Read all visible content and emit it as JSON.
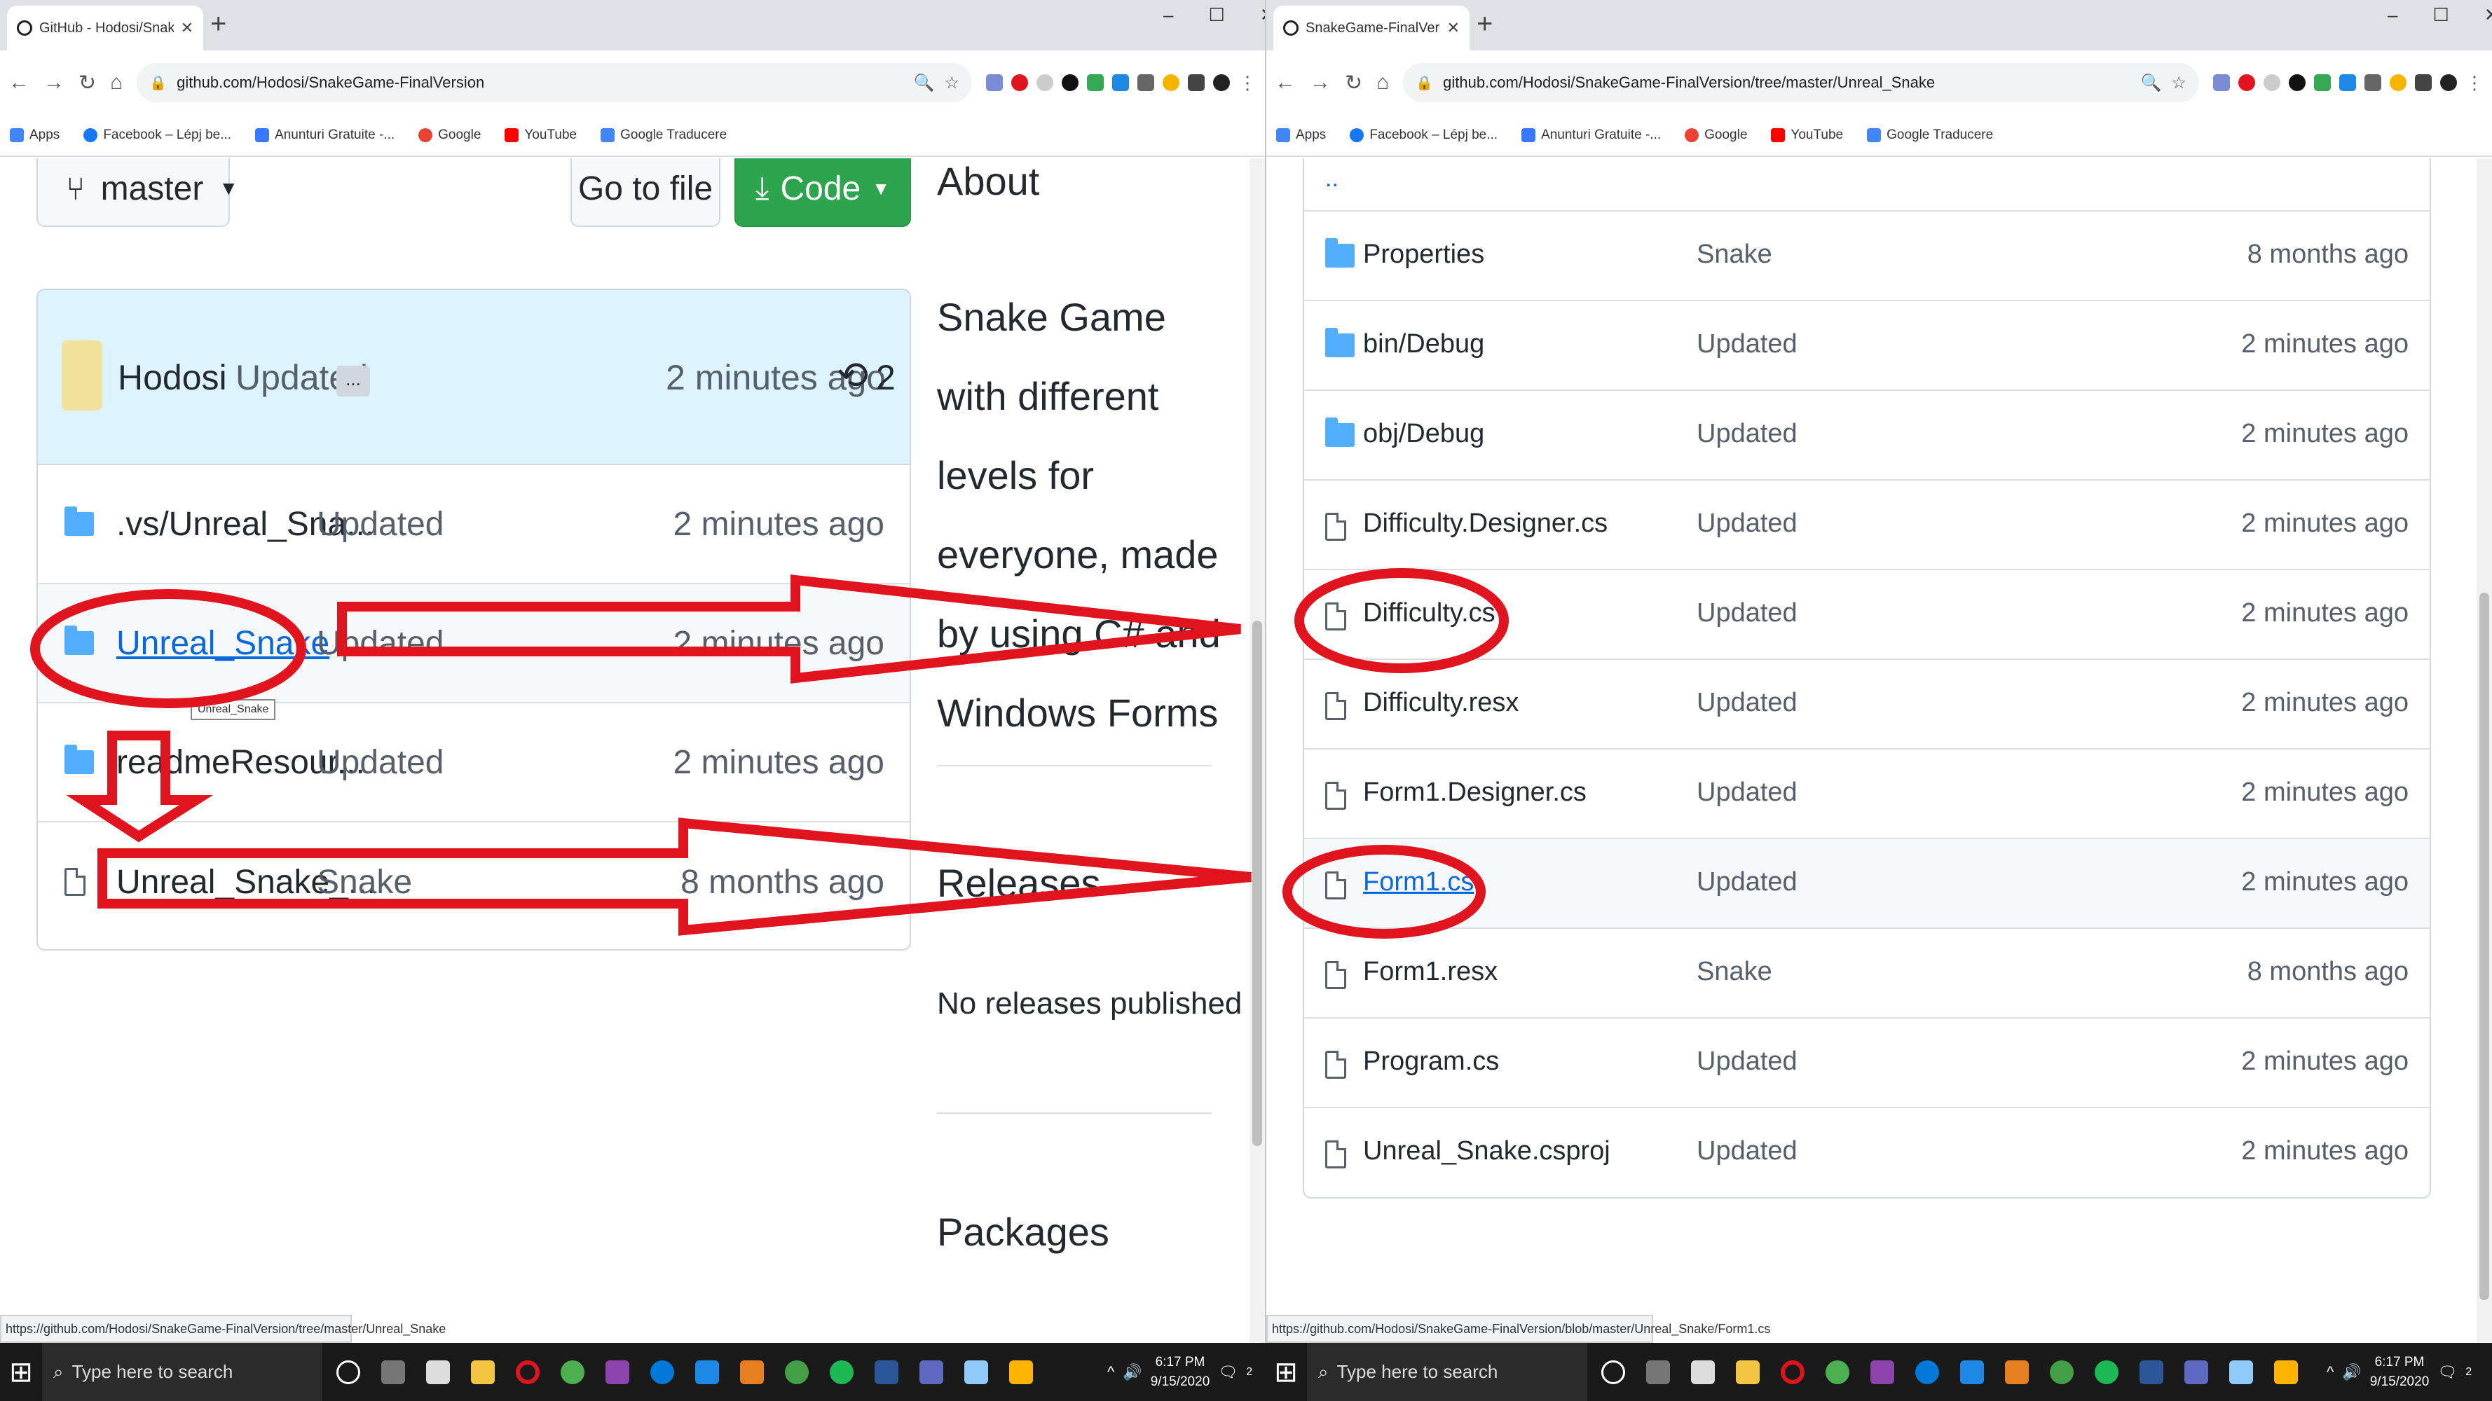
{
  "left_browser": {
    "tab_title": "GitHub - Hodosi/SnakeGame-Fi",
    "url": "github.com/Hodosi/SnakeGame-FinalVersion",
    "branch_label": "master",
    "go_to_file_label": "Go to file",
    "code_label": "Code",
    "commit": {
      "author": "Hodosi",
      "message": "Updated",
      "ellipsis": "...",
      "time": "2 minutes ago",
      "count": "2"
    },
    "files": [
      {
        "name": ".vs/Unreal_Sna...",
        "message": "Updated",
        "age": "2 minutes ago",
        "type": "folder"
      },
      {
        "name": "Unreal_Snake",
        "message": "Updated",
        "age": "2 minutes ago",
        "type": "folder",
        "link": true
      },
      {
        "name": "readmeResour...",
        "message": "Updated",
        "age": "2 minutes ago",
        "type": "folder"
      },
      {
        "name": "Unreal_Snake_...",
        "message": "Snake",
        "age": "8 months ago",
        "type": "file"
      }
    ],
    "tooltip": "Unreal_Snake",
    "about_title": "About",
    "about_desc": "Snake Game with different levels for everyone, made by using C# and Windows Forms",
    "releases_title": "Releases",
    "releases_text": "No releases published",
    "packages_title": "Packages",
    "status_url": "https://github.com/Hodosi/SnakeGame-FinalVersion/tree/master/Unreal_Snake"
  },
  "right_browser": {
    "tab_title": "SnakeGame-FinalVersion/Unrea",
    "url": "github.com/Hodosi/SnakeGame-FinalVersion/tree/master/Unreal_Snake",
    "parent_dir": "..",
    "files": [
      {
        "name": "Properties",
        "message": "Snake",
        "age": "8 months ago",
        "type": "folder"
      },
      {
        "name": "bin/Debug",
        "message": "Updated",
        "age": "2 minutes ago",
        "type": "folder"
      },
      {
        "name": "obj/Debug",
        "message": "Updated",
        "age": "2 minutes ago",
        "type": "folder"
      },
      {
        "name": "Difficulty.Designer.cs",
        "message": "Updated",
        "age": "2 minutes ago",
        "type": "file"
      },
      {
        "name": "Difficulty.cs",
        "message": "Updated",
        "age": "2 minutes ago",
        "type": "file"
      },
      {
        "name": "Difficulty.resx",
        "message": "Updated",
        "age": "2 minutes ago",
        "type": "file"
      },
      {
        "name": "Form1.Designer.cs",
        "message": "Updated",
        "age": "2 minutes ago",
        "type": "file"
      },
      {
        "name": "Form1.cs",
        "message": "Updated",
        "age": "2 minutes ago",
        "type": "file",
        "link": true
      },
      {
        "name": "Form1.resx",
        "message": "Snake",
        "age": "8 months ago",
        "type": "file"
      },
      {
        "name": "Program.cs",
        "message": "Updated",
        "age": "2 minutes ago",
        "type": "file"
      },
      {
        "name": "Unreal_Snake.csproj",
        "message": "Updated",
        "age": "2 minutes ago",
        "type": "file"
      }
    ],
    "status_url": "https://github.com/Hodosi/SnakeGame-FinalVersion/blob/master/Unreal_Snake/Form1.cs"
  },
  "bookmarks": [
    {
      "label": "Apps",
      "icon": "apps-icon",
      "color": "#4285f4"
    },
    {
      "label": "Facebook – Lépj be...",
      "icon": "facebook-icon",
      "color": "#1877f2"
    },
    {
      "label": "Anunturi Gratuite -...",
      "icon": "olx-icon",
      "color": "#3a77ff"
    },
    {
      "label": "Google",
      "icon": "google-icon",
      "color": "#ea4335"
    },
    {
      "label": "YouTube",
      "icon": "youtube-icon",
      "color": "#ff0000"
    },
    {
      "label": "Google Traducere",
      "icon": "translate-icon",
      "color": "#4285f4"
    }
  ],
  "taskbar": {
    "search_placeholder": "Type here to search",
    "time": "6:17 PM",
    "date": "9/15/2020",
    "notification_count": "2"
  },
  "annotation_color": "#e0141e",
  "colors": {
    "github_green": "#2da44e",
    "folder_blue": "#54aeff",
    "commit_bg": "#ddf4ff",
    "link_blue": "#0969da"
  }
}
